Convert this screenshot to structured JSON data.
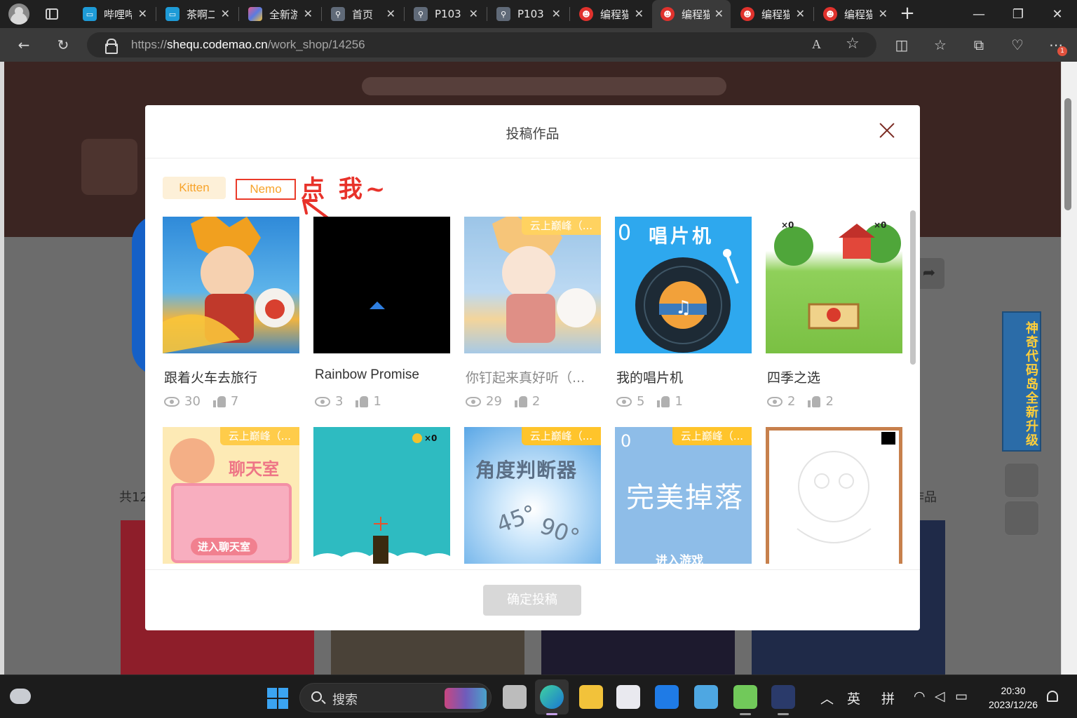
{
  "browser": {
    "tabs": [
      {
        "title": "哔哩哔",
        "favicon": "bilibili-icon"
      },
      {
        "title": "茶啊二",
        "favicon": "bilibili-icon"
      },
      {
        "title": "全新游",
        "favicon": "game-icon"
      },
      {
        "title": "首页",
        "favicon": "site-icon"
      },
      {
        "title": "P103",
        "favicon": "site-icon"
      },
      {
        "title": "P103",
        "favicon": "site-icon"
      },
      {
        "title": "编程猫",
        "favicon": "codemao-icon"
      },
      {
        "title": "编程猫",
        "favicon": "codemao-icon",
        "active": true
      },
      {
        "title": "编程猫",
        "favicon": "codemao-icon"
      },
      {
        "title": "编程猫",
        "favicon": "codemao-icon"
      }
    ],
    "url_prefix": "https://",
    "url_host": "sheq​u.codemao.cn",
    "url_path": "/work_shop/14256",
    "read_aloud_label": "A",
    "notification_badge": "1"
  },
  "page": {
    "count_left": "共12",
    "count_right": "作品",
    "side_ad_text": "神奇代码岛全新升级"
  },
  "modal": {
    "title": "投稿作品",
    "filters": [
      {
        "label": "Kitten",
        "active": true
      },
      {
        "label": "Nemo",
        "highlighted": true
      }
    ],
    "annotation": "点 我~",
    "works": [
      {
        "title": "跟着火车去旅行",
        "views": "30",
        "likes": "7",
        "tag": ""
      },
      {
        "title": "Rainbow Promise",
        "views": "3",
        "likes": "1",
        "tag": ""
      },
      {
        "title": "你钉起来真好听（...",
        "views": "29",
        "likes": "2",
        "tag": "云上巅峰（..."
      },
      {
        "title": "我的唱片机",
        "views": "5",
        "likes": "1",
        "tag": "",
        "thumb_text": "唱片机",
        "thumb_score": "0"
      },
      {
        "title": "四季之选",
        "views": "2",
        "likes": "2",
        "tag": "",
        "thumb_score_a": "×0",
        "thumb_score_b": "×0"
      },
      {
        "title": "",
        "views": "",
        "likes": "",
        "tag": "云上巅峰（...",
        "thumb_text": "聊天室",
        "thumb_button": "进入聊天室"
      },
      {
        "title": "",
        "views": "",
        "likes": "",
        "tag": "",
        "thumb_score": "×0"
      },
      {
        "title": "",
        "views": "",
        "likes": "",
        "tag": "云上巅峰（...",
        "thumb_text": "角度判断器",
        "thumb_a": "45°",
        "thumb_b": "90°"
      },
      {
        "title": "",
        "views": "",
        "likes": "",
        "tag": "云上巅峰（...",
        "thumb_text": "完美掉落",
        "thumb_score": "0",
        "thumb_button": "进入游戏"
      },
      {
        "title": "",
        "views": "",
        "likes": "",
        "tag": ""
      }
    ],
    "confirm_label": "确定投稿"
  },
  "taskbar": {
    "search_label": "搜索",
    "ime_lang": "英",
    "ime_mode": "拼",
    "time": "20:30",
    "date": "2023/12/26"
  },
  "colors": {
    "accent_orange": "#f7a32a",
    "tag_yellow": "#ffc42b",
    "annotation_red": "#e8322a",
    "disabled_button": "#d8d8d8"
  }
}
